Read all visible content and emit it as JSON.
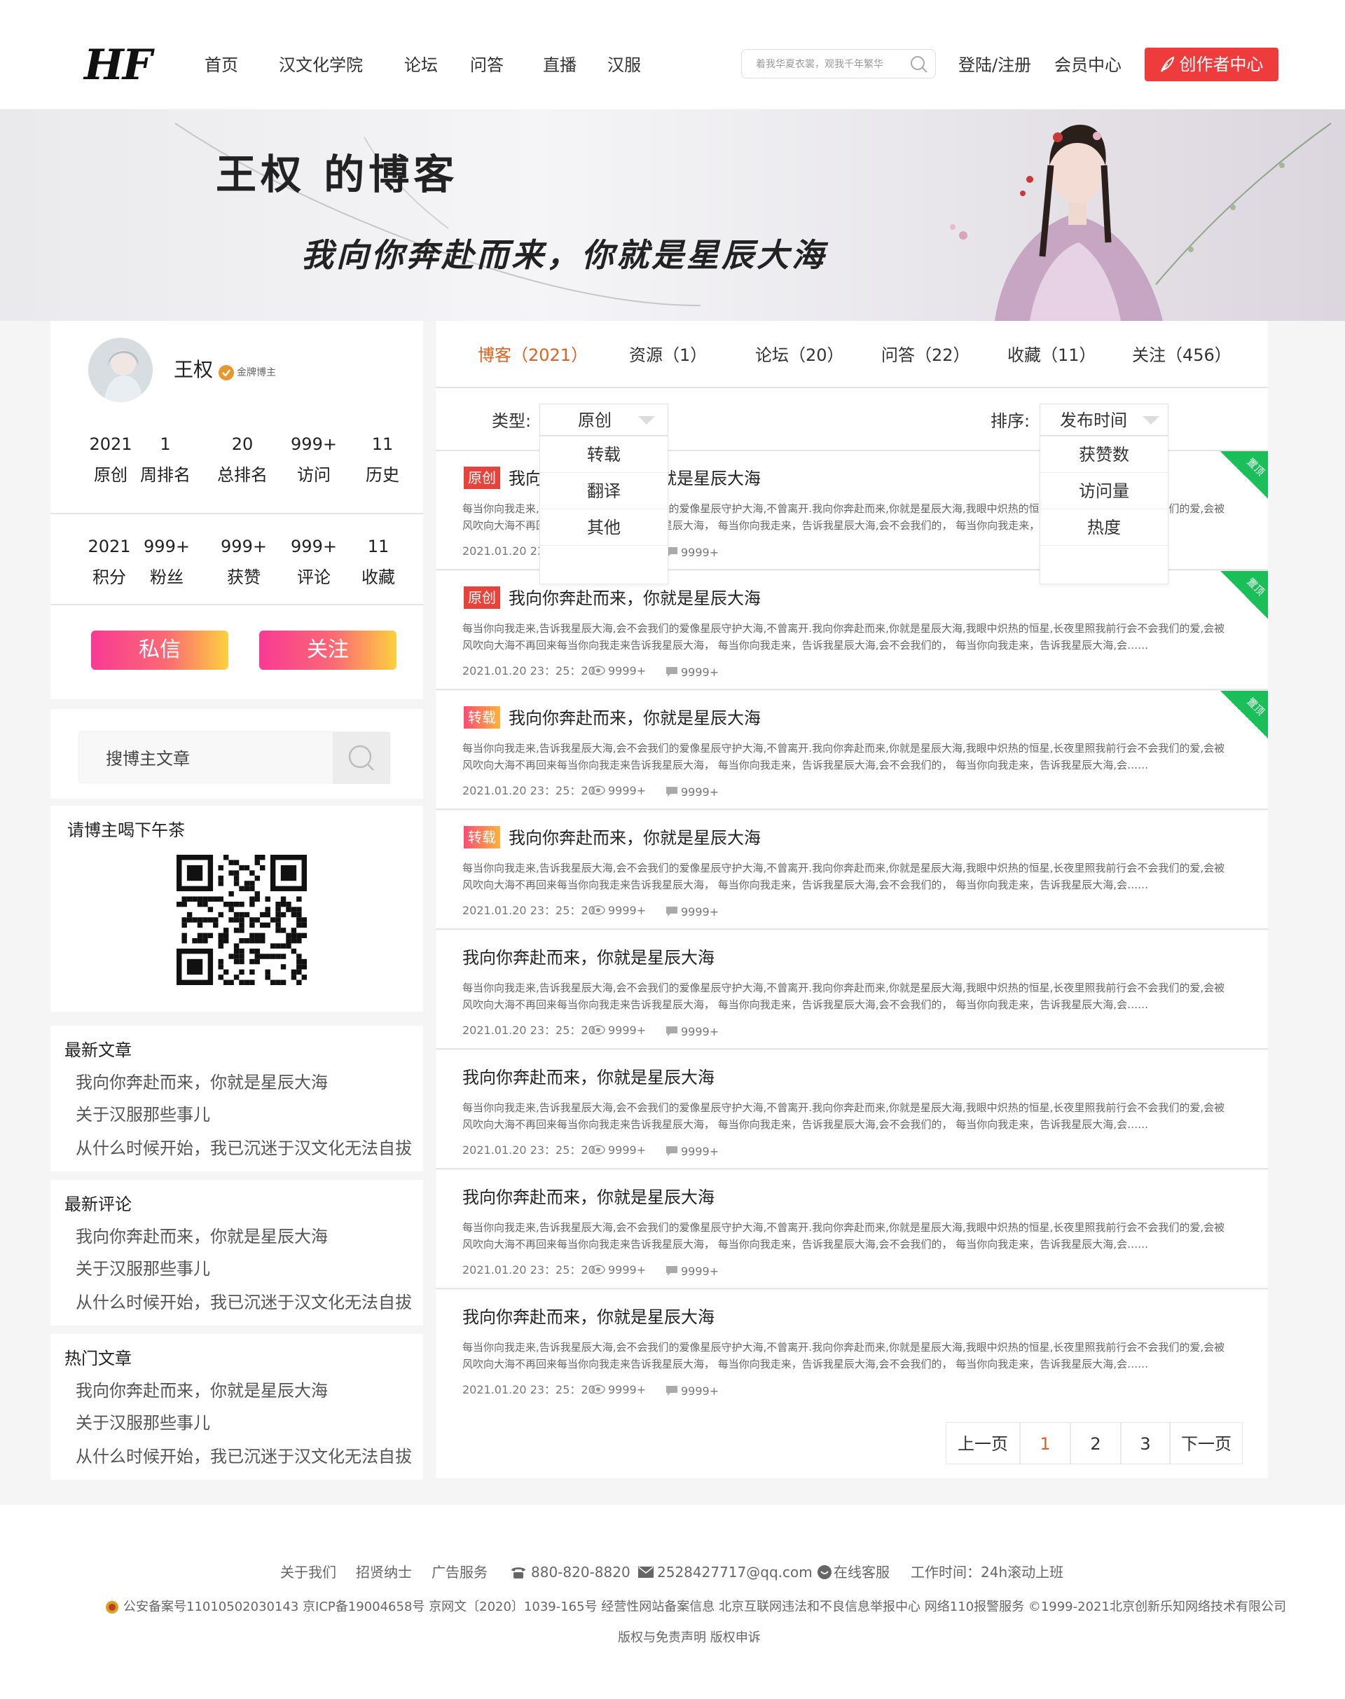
{
  "header": {
    "logo": "HF",
    "nav": [
      "首页",
      "汉文化学院",
      "论坛",
      "问答",
      "直播",
      "汉服"
    ],
    "search_placeholder": "着我华夏衣裳，观我千年繁华",
    "login": "登陆/注册",
    "vip": "会员中心",
    "creator": "创作者中心",
    "accent": "#ee3b3b"
  },
  "banner": {
    "title": "王权  的博客",
    "subtitle": "我向你奔赴而来，你就是星辰大海"
  },
  "profile": {
    "name": "王权",
    "badge": "金牌博主",
    "stats1": [
      {
        "n": "2021",
        "l": "原创"
      },
      {
        "n": "1",
        "l": "周排名"
      },
      {
        "n": "20",
        "l": "总排名"
      },
      {
        "n": "999+",
        "l": "访问"
      },
      {
        "n": "11",
        "l": "历史"
      }
    ],
    "stats2": [
      {
        "n": "2021",
        "l": "积分"
      },
      {
        "n": "999+",
        "l": "粉丝"
      },
      {
        "n": "999+",
        "l": "获赞"
      },
      {
        "n": "999+",
        "l": "评论"
      },
      {
        "n": "11",
        "l": "收藏"
      }
    ],
    "msg_btn": "私信",
    "follow_btn": "关注"
  },
  "blog_search": {
    "placeholder": "搜博主文章"
  },
  "tea": {
    "title": "请博主喝下午茶"
  },
  "lists": [
    {
      "title": "最新文章",
      "items": [
        "我向你奔赴而来，你就是星辰大海",
        "关于汉服那些事儿",
        "从什么时候开始，我已沉迷于汉文化无法自拔"
      ]
    },
    {
      "title": "最新评论",
      "items": [
        "我向你奔赴而来，你就是星辰大海",
        "关于汉服那些事儿",
        "从什么时候开始，我已沉迷于汉文化无法自拔"
      ]
    },
    {
      "title": "热门文章",
      "items": [
        "我向你奔赴而来，你就是星辰大海",
        "关于汉服那些事儿",
        "从什么时候开始，我已沉迷于汉文化无法自拔"
      ]
    }
  ],
  "tabs": [
    "博客（2021）",
    "资源（1）",
    "论坛（20）",
    "问答（22）",
    "收藏（11）",
    "关注（456）"
  ],
  "filter": {
    "type_label": "类型:",
    "type_value": "原创",
    "type_options": [
      "转载",
      "翻译",
      "其他"
    ],
    "sort_label": "排序:",
    "sort_value": "发布时间",
    "sort_options": [
      "获赞数",
      "访问量",
      "热度"
    ]
  },
  "article_common": {
    "title": "我向你奔赴而来，你就是星辰大海",
    "summary": "每当你向我走来,告诉我星辰大海,会不会我们的爱像星辰守护大海,不曾离开.我向你奔赴而来,你就是星辰大海,我眼中炽热的恒星,长夜里照我前行会不会我们的爱,会被风吹向大海不再回来每当你向我走来告诉我星辰大海，  每当你向我走来，告诉我星辰大海,会不会我们的，  每当你向我走来，告诉我星辰大海,会……",
    "date": "2021.01.20  23：25：20",
    "views": "9999+",
    "comments": "9999+"
  },
  "articles": [
    {
      "tag": "原创",
      "top": "置顶"
    },
    {
      "tag": "原创",
      "top": "置顶"
    },
    {
      "tag": "转载",
      "top": "置顶"
    },
    {
      "tag": "转载",
      "top": ""
    },
    {
      "tag": "",
      "top": ""
    },
    {
      "tag": "",
      "top": ""
    },
    {
      "tag": "",
      "top": ""
    },
    {
      "tag": "",
      "top": ""
    }
  ],
  "pager": {
    "prev": "上一页",
    "pages": [
      "1",
      "2",
      "3"
    ],
    "next": "下一页",
    "current": "1"
  },
  "footer": {
    "links": [
      "关于我们",
      "招贤纳士",
      "广告服务"
    ],
    "phone": "880-820-8820",
    "email": "2528427717@qq.com",
    "service": "在线客服",
    "hours": "工作时间：24h滚动上班",
    "record": "公安备案号11010502030143  京ICP备19004658号  京网文〔2020〕1039-165号  经营性网站备案信息  北京互联网违法和不良信息举报中心  网络110报警服务  ©1999-2021北京创新乐知网络技术有限公司",
    "copyright": "版权与免责声明  版权申诉"
  }
}
